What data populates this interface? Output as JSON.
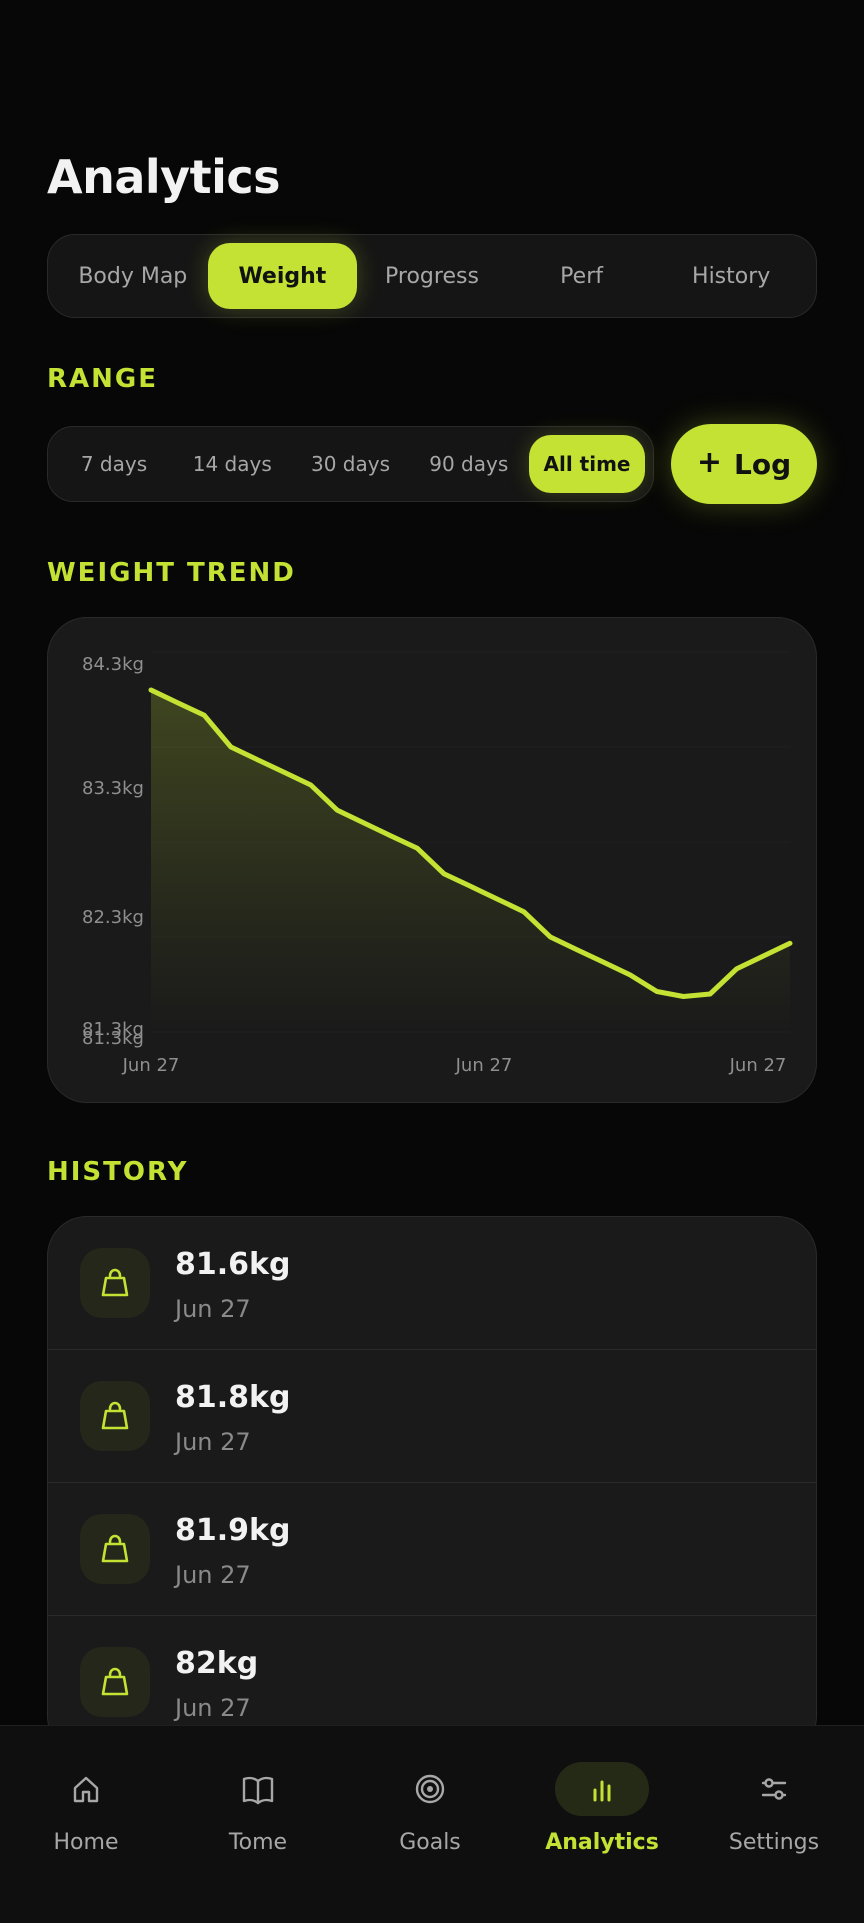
{
  "page": {
    "title": "Analytics"
  },
  "tabs": [
    {
      "label": "Body Map",
      "active": false
    },
    {
      "label": "Weight",
      "active": true
    },
    {
      "label": "Progress",
      "active": false
    },
    {
      "label": "Perf",
      "active": false
    },
    {
      "label": "History",
      "active": false
    }
  ],
  "sections": {
    "range": "RANGE",
    "weight_trend": "WEIGHT TREND",
    "history": "HISTORY"
  },
  "range": {
    "options": [
      {
        "label": "7 days",
        "active": false
      },
      {
        "label": "14 days",
        "active": false
      },
      {
        "label": "30 days",
        "active": false
      },
      {
        "label": "90 days",
        "active": false
      },
      {
        "label": "All time",
        "active": true
      }
    ]
  },
  "actions": {
    "log_plus": "+",
    "log_label": "Log"
  },
  "colors": {
    "accent": "#c3e233",
    "background": "#070707",
    "panel": "#151515"
  },
  "chart_data": {
    "type": "area",
    "title": "",
    "xlabel": "",
    "ylabel": "",
    "x_ticks": [
      "Jun 27",
      "Jun 27",
      "Jun 27"
    ],
    "y_ticks": [
      "84.3kg",
      "83.3kg",
      "82.3kg",
      "81.3kg",
      "81.3kg"
    ],
    "ylim": [
      81.3,
      84.3
    ],
    "x": [
      0,
      1,
      2,
      3,
      4,
      5,
      6,
      7,
      8,
      9,
      10,
      11,
      12,
      13,
      14,
      15,
      16,
      17,
      18,
      19,
      20,
      21,
      22,
      23,
      24
    ],
    "series": [
      {
        "values": [
          84.0,
          83.9,
          83.8,
          83.55,
          83.45,
          83.35,
          83.25,
          83.05,
          82.95,
          82.85,
          82.75,
          82.55,
          82.45,
          82.35,
          82.25,
          82.05,
          81.95,
          81.85,
          81.75,
          81.62,
          81.58,
          81.6,
          81.8,
          81.9,
          82.0
        ]
      }
    ],
    "grid": true,
    "legend": "none"
  },
  "history": {
    "items": [
      {
        "value": "81.6kg",
        "date": "Jun 27",
        "icon": "weight-icon"
      },
      {
        "value": "81.8kg",
        "date": "Jun 27",
        "icon": "weight-icon"
      },
      {
        "value": "81.9kg",
        "date": "Jun 27",
        "icon": "weight-icon"
      },
      {
        "value": "82kg",
        "date": "Jun 27",
        "icon": "weight-icon"
      }
    ]
  },
  "bottom_nav": [
    {
      "label": "Home",
      "icon": "home-icon",
      "active": false
    },
    {
      "label": "Tome",
      "icon": "book-icon",
      "active": false
    },
    {
      "label": "Goals",
      "icon": "target-icon",
      "active": false
    },
    {
      "label": "Analytics",
      "icon": "analytics-icon",
      "active": true
    },
    {
      "label": "Settings",
      "icon": "settings-icon",
      "active": false
    }
  ]
}
